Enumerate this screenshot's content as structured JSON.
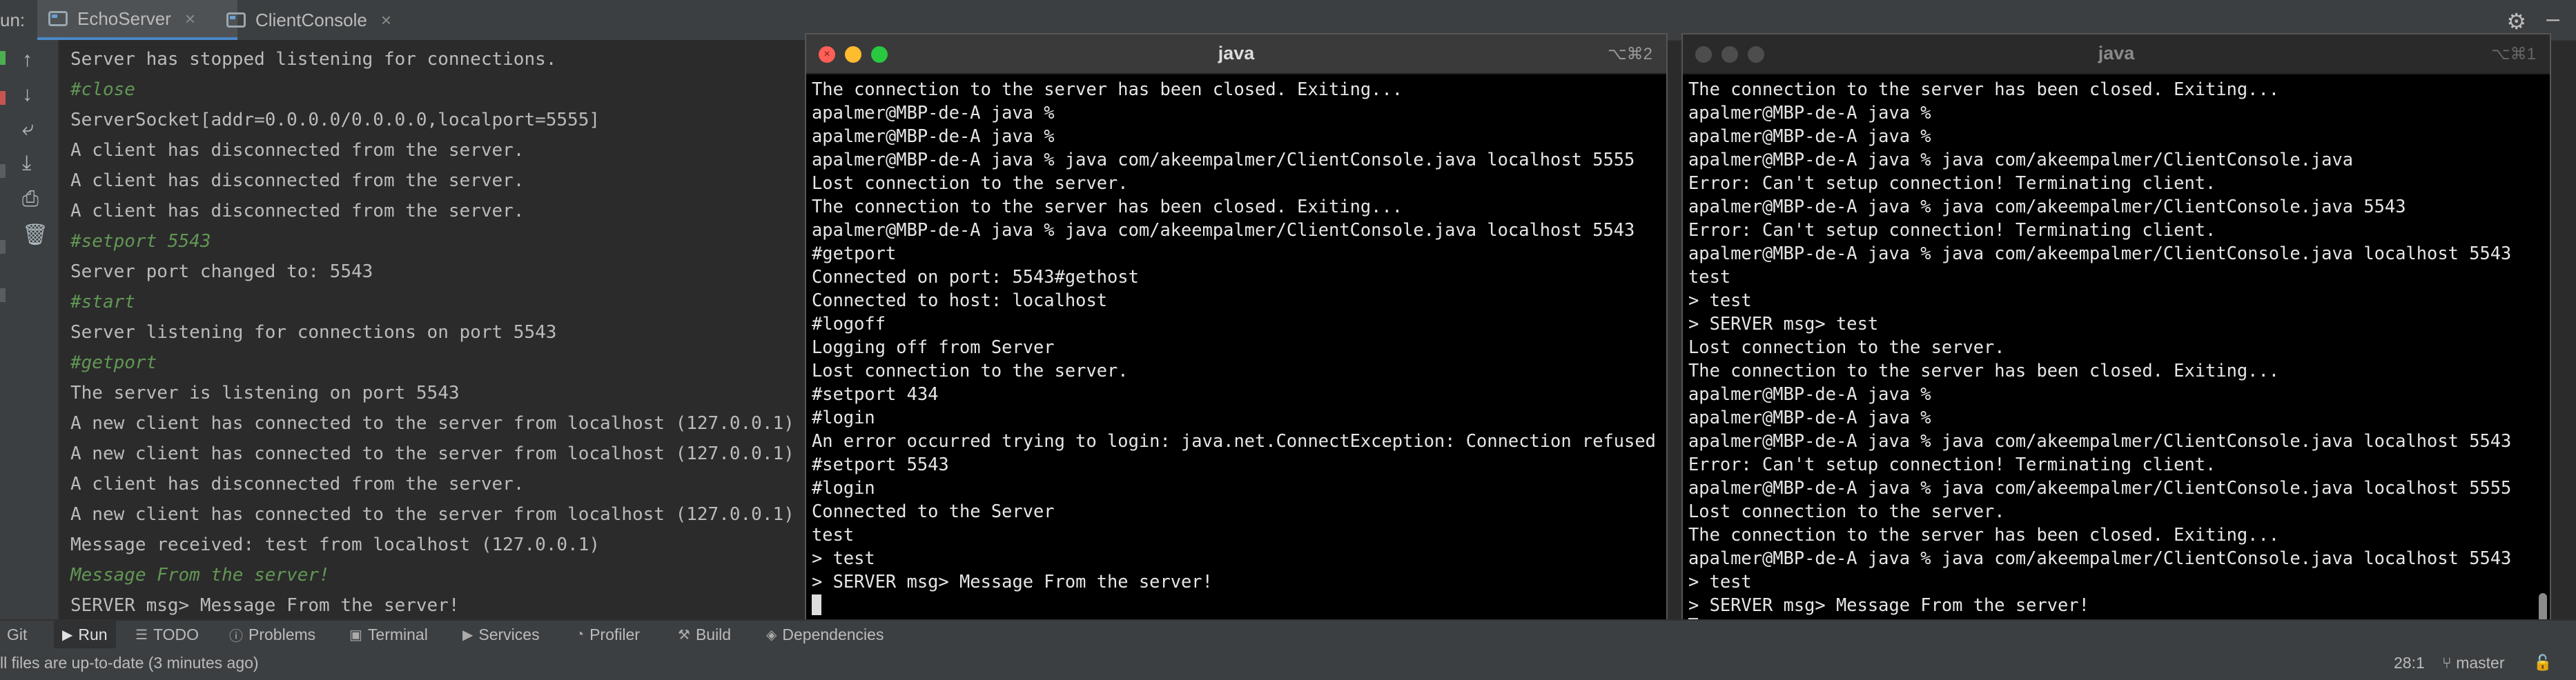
{
  "ide": {
    "run_label": "un:",
    "tabs": [
      {
        "label": "EchoServer",
        "active": true
      },
      {
        "label": "ClientConsole",
        "active": false
      }
    ]
  },
  "console": {
    "lines": [
      {
        "text": "Server has stopped listening for connections.",
        "type": "output"
      },
      {
        "text": "#close",
        "type": "cmd"
      },
      {
        "text": "ServerSocket[addr=0.0.0.0/0.0.0.0,localport=5555]",
        "type": "output"
      },
      {
        "text": "A client has disconnected from the server.",
        "type": "output"
      },
      {
        "text": "A client has disconnected from the server.",
        "type": "output"
      },
      {
        "text": "A client has disconnected from the server.",
        "type": "output"
      },
      {
        "text": "#setport 5543",
        "type": "cmd"
      },
      {
        "text": "Server port changed to: 5543",
        "type": "output"
      },
      {
        "text": "#start",
        "type": "cmd"
      },
      {
        "text": "Server listening for connections on port 5543",
        "type": "output"
      },
      {
        "text": "#getport",
        "type": "cmd"
      },
      {
        "text": "The server is listening on port 5543",
        "type": "output"
      },
      {
        "text": "A new client has connected to the server from localhost (127.0.0.1)",
        "type": "output"
      },
      {
        "text": "A new client has connected to the server from localhost (127.0.0.1)",
        "type": "output"
      },
      {
        "text": "A client has disconnected from the server.",
        "type": "output"
      },
      {
        "text": "A new client has connected to the server from localhost (127.0.0.1)",
        "type": "output"
      },
      {
        "text": "Message received: test from localhost (127.0.0.1)",
        "type": "output"
      },
      {
        "text": "Message From the server!",
        "type": "cmd"
      },
      {
        "text": "SERVER msg> Message From the server!",
        "type": "output"
      }
    ]
  },
  "tool_windows": {
    "items": [
      {
        "label": "Git",
        "icon": "git-icon"
      },
      {
        "label": "Run",
        "icon": "run-icon",
        "active": true
      },
      {
        "label": "TODO",
        "icon": "todo-icon"
      },
      {
        "label": "Problems",
        "icon": "problems-icon"
      },
      {
        "label": "Terminal",
        "icon": "terminal-icon"
      },
      {
        "label": "Services",
        "icon": "services-icon"
      },
      {
        "label": "Profiler",
        "icon": "profiler-icon"
      },
      {
        "label": "Build",
        "icon": "build-icon"
      },
      {
        "label": "Dependencies",
        "icon": "dependencies-icon"
      }
    ]
  },
  "status_bar": {
    "message": "ll files are up-to-date (3 minutes ago)",
    "cursor_position": "28:1",
    "branch": "master"
  },
  "terminal_1": {
    "title": "java",
    "shortcut": "⌥⌘2",
    "lines": [
      "The connection to the server has been closed. Exiting...",
      "apalmer@MBP-de-A java %",
      "apalmer@MBP-de-A java %",
      "apalmer@MBP-de-A java % java com/akeempalmer/ClientConsole.java localhost 5555",
      "Lost connection to the server.",
      "The connection to the server has been closed. Exiting...",
      "apalmer@MBP-de-A java % java com/akeempalmer/ClientConsole.java localhost 5543",
      "#getport",
      "Connected on port: 5543#gethost",
      "Connected to host: localhost",
      "#logoff",
      "Logging off from Server",
      "Lost connection to the server.",
      "#setport 434",
      "#login",
      "An error occurred trying to login: java.net.ConnectException: Connection refused",
      "#setport 5543",
      "#login",
      "Connected to the Server",
      "test",
      "> test",
      "> SERVER msg> Message From the server!"
    ]
  },
  "terminal_2": {
    "title": "java",
    "shortcut": "⌥⌘1",
    "lines": [
      "The connection to the server has been closed. Exiting...",
      "apalmer@MBP-de-A java %",
      "apalmer@MBP-de-A java %",
      "apalmer@MBP-de-A java % java com/akeempalmer/ClientConsole.java",
      "Error: Can't setup connection! Terminating client.",
      "apalmer@MBP-de-A java % java com/akeempalmer/ClientConsole.java 5543",
      "Error: Can't setup connection! Terminating client.",
      "apalmer@MBP-de-A java % java com/akeempalmer/ClientConsole.java localhost 5543",
      "test",
      "> test",
      "> SERVER msg> test",
      "Lost connection to the server.",
      "The connection to the server has been closed. Exiting...",
      "apalmer@MBP-de-A java %",
      "apalmer@MBP-de-A java %",
      "apalmer@MBP-de-A java % java com/akeempalmer/ClientConsole.java localhost 5543",
      "Error: Can't setup connection! Terminating client.",
      "apalmer@MBP-de-A java % java com/akeempalmer/ClientConsole.java localhost 5555",
      "Lost connection to the server.",
      "The connection to the server has been closed. Exiting...",
      "apalmer@MBP-de-A java % java com/akeempalmer/ClientConsole.java localhost 5543",
      "> test",
      "> SERVER msg> Message From the server!"
    ]
  },
  "colors": {
    "ide_background": "#2b2b2b",
    "ide_panel": "#3c3f41",
    "console_command": "#629755",
    "console_text": "#bbbbbb",
    "terminal_background": "#000000",
    "terminal_text": "#e6e6e6"
  }
}
